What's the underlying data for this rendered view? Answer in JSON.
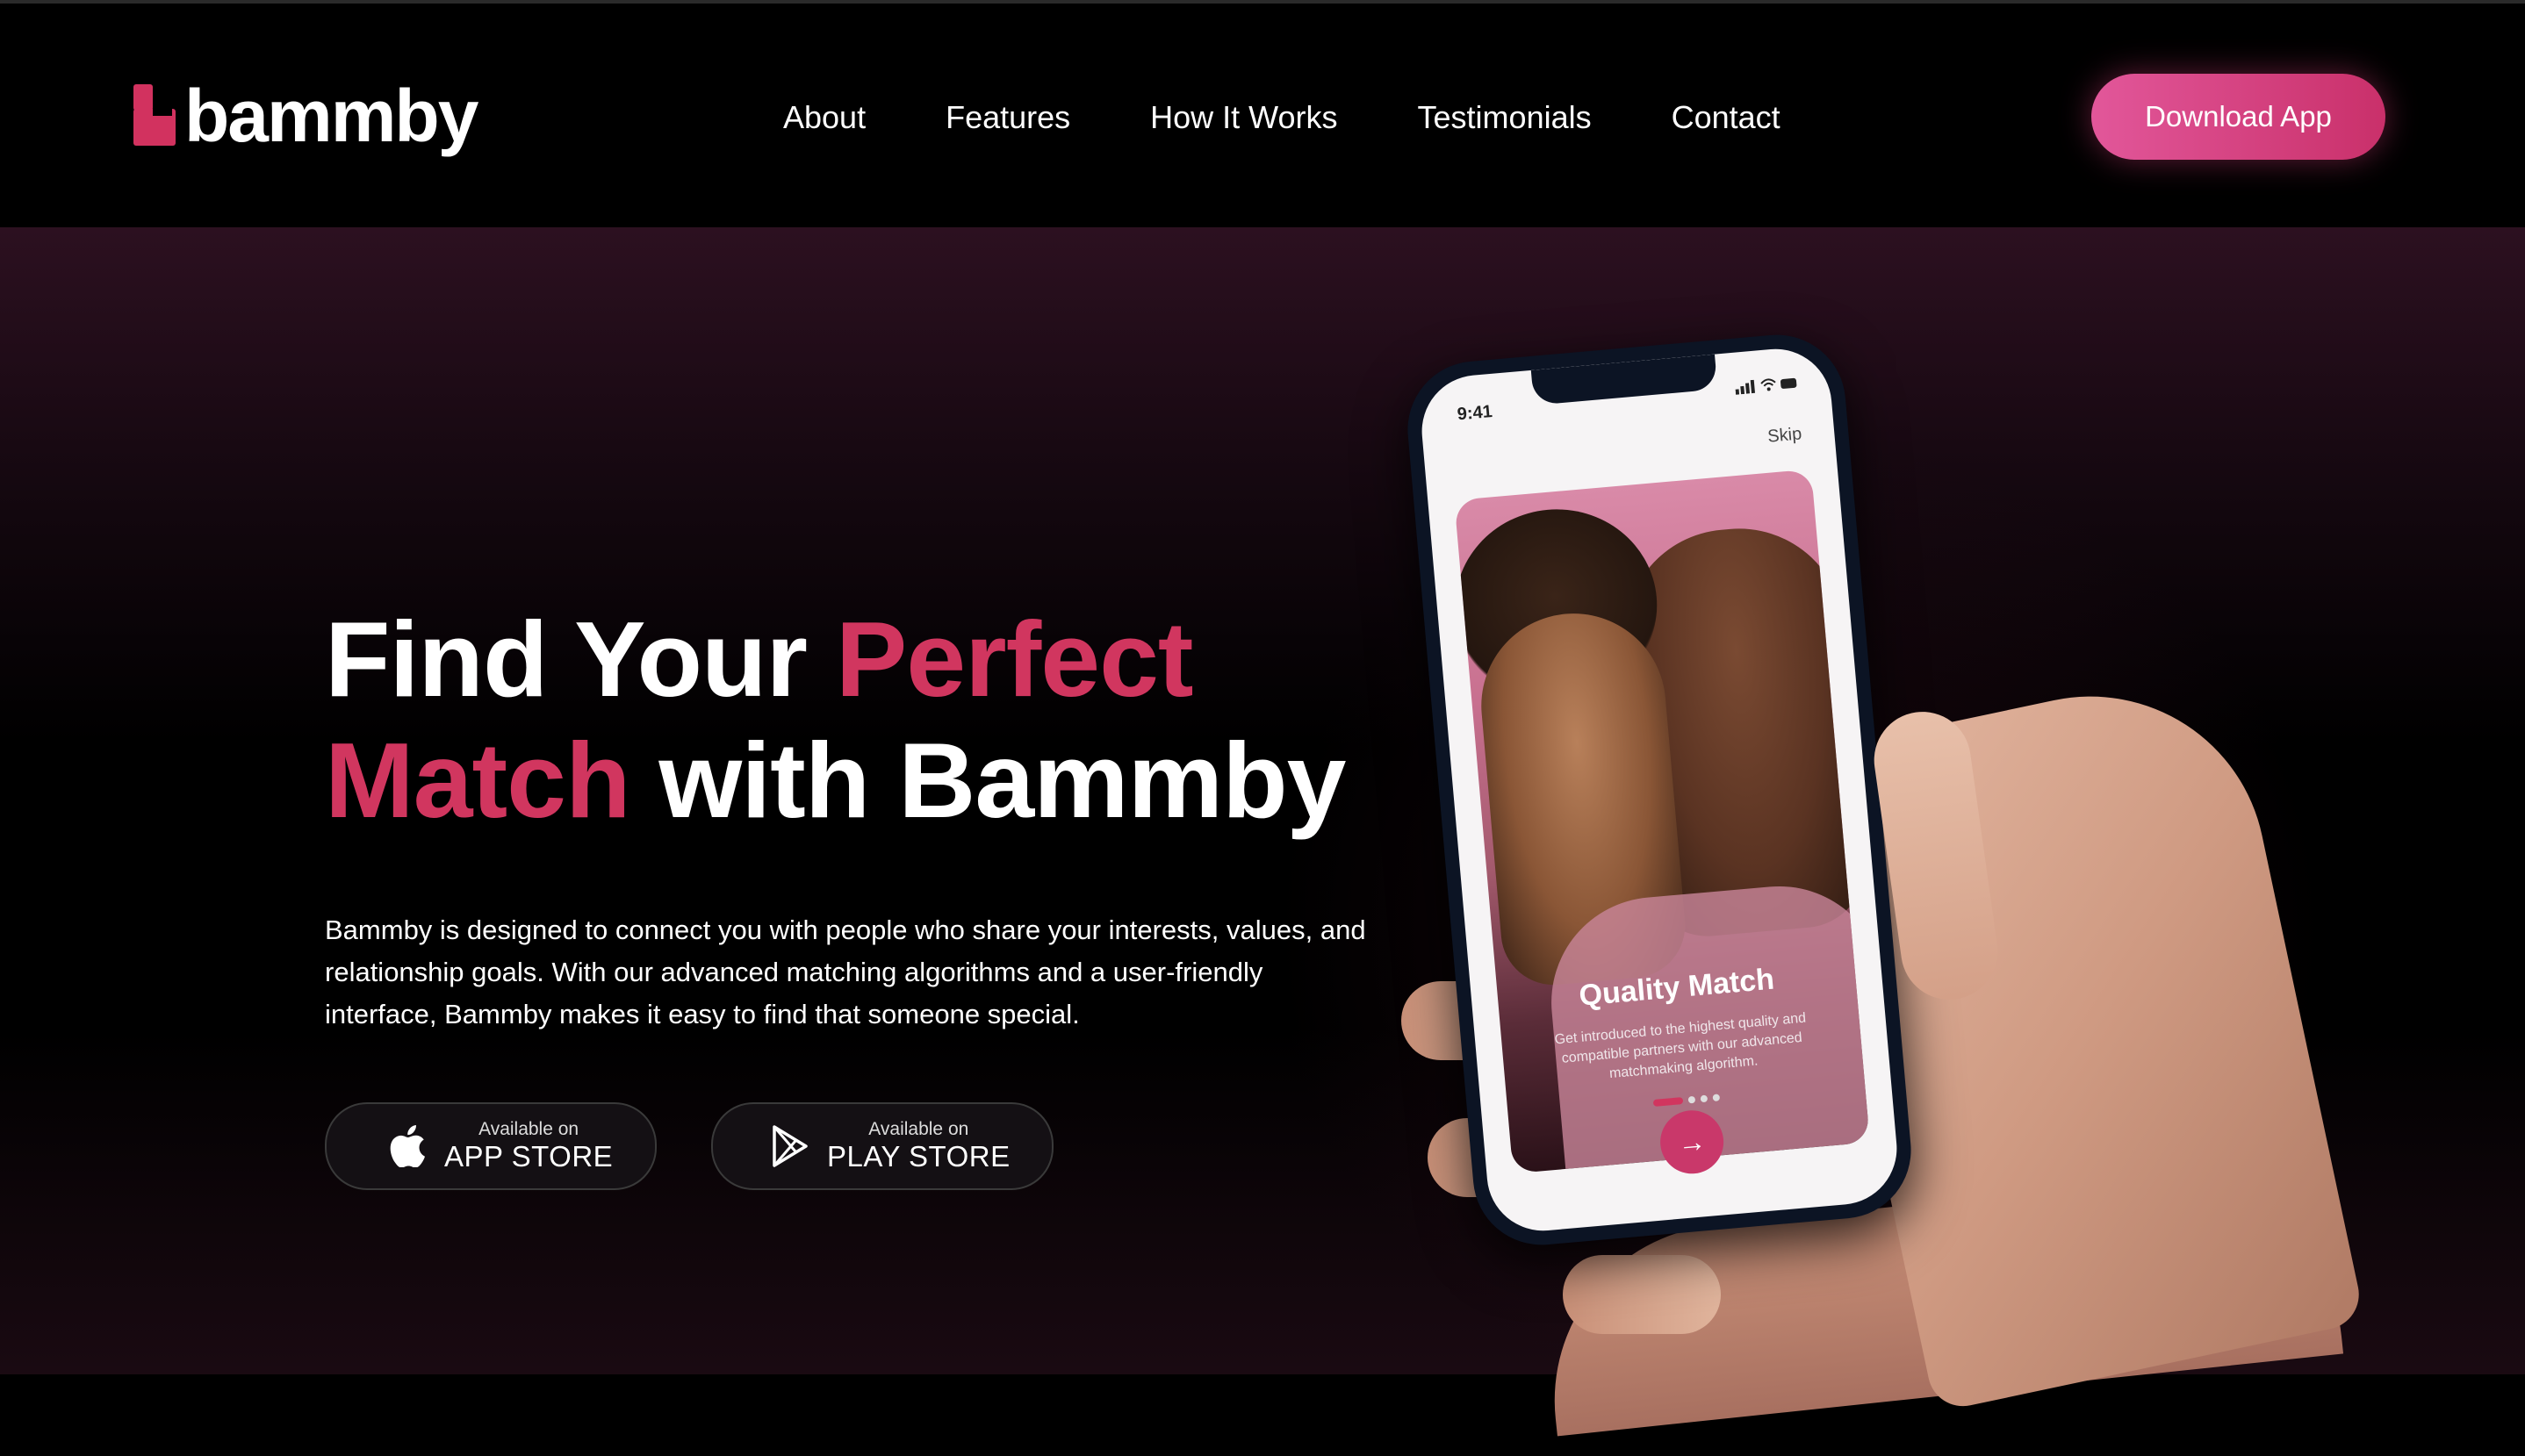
{
  "brand": {
    "name": "bammby",
    "accent": "#d1365f"
  },
  "nav": {
    "items": [
      "About",
      "Features",
      "How It Works",
      "Testimonials",
      "Contact"
    ],
    "download_label": "Download App"
  },
  "hero": {
    "headline_line1_white": "Find Your",
    "headline_line1_pink": "Perfect",
    "headline_line2_pink": "Match",
    "headline_line2_white": "with Bammby",
    "description": "Bammby is designed to connect you with people who share your interests, values, and relationship goals. With our advanced matching algorithms and a user-friendly interface, Bammby makes it easy to find that someone special.",
    "app_store": {
      "small": "Available on",
      "big": "APP STORE",
      "icon": "apple-icon"
    },
    "play_store": {
      "small": "Available on",
      "big": "PLAY STORE",
      "icon": "play-store-icon"
    }
  },
  "phone": {
    "time": "9:41",
    "skip_label": "Skip",
    "card_title": "Quality Match",
    "card_desc": "Get introduced to the highest quality and compatible partners with our advanced matchmaking algorithm.",
    "next_icon": "arrow-right-icon"
  }
}
